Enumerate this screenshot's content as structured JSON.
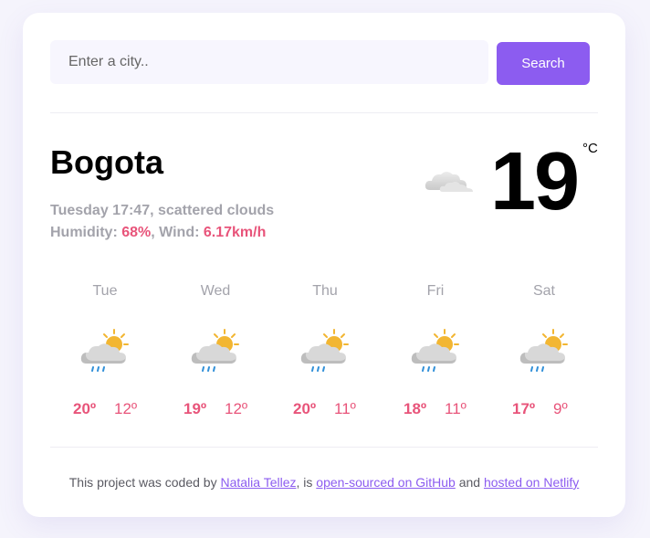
{
  "search": {
    "placeholder": "Enter a city..",
    "button_label": "Search"
  },
  "current": {
    "city": "Bogota",
    "datetime": "Tuesday 17:47",
    "separator": ", ",
    "description": "scattered clouds",
    "humidity_label": "Humidity: ",
    "humidity_value": "68%",
    "comma": ", ",
    "wind_label": "Wind: ",
    "wind_value": "6.17km/h",
    "temperature": "19",
    "unit": "°C",
    "icon": "scattered-clouds-icon"
  },
  "forecast": [
    {
      "day": "Tue",
      "max": "20º",
      "min": "12º",
      "icon": "sun-cloud-rain-icon"
    },
    {
      "day": "Wed",
      "max": "19º",
      "min": "12º",
      "icon": "sun-cloud-rain-icon"
    },
    {
      "day": "Thu",
      "max": "20º",
      "min": "11º",
      "icon": "sun-cloud-rain-icon"
    },
    {
      "day": "Fri",
      "max": "18º",
      "min": "11º",
      "icon": "sun-cloud-rain-icon"
    },
    {
      "day": "Sat",
      "max": "17º",
      "min": "9º",
      "icon": "sun-cloud-rain-icon"
    }
  ],
  "footer": {
    "text1": "This project was coded by ",
    "author": "Natalia Tellez",
    "text2": ", is ",
    "github_link": "open-sourced on GitHub",
    "text3": " and ",
    "netlify_link": "hosted on Netlify"
  },
  "colors": {
    "accent": "#8c5cf0",
    "highlight": "#e8547a",
    "muted": "#a3a3ab"
  }
}
